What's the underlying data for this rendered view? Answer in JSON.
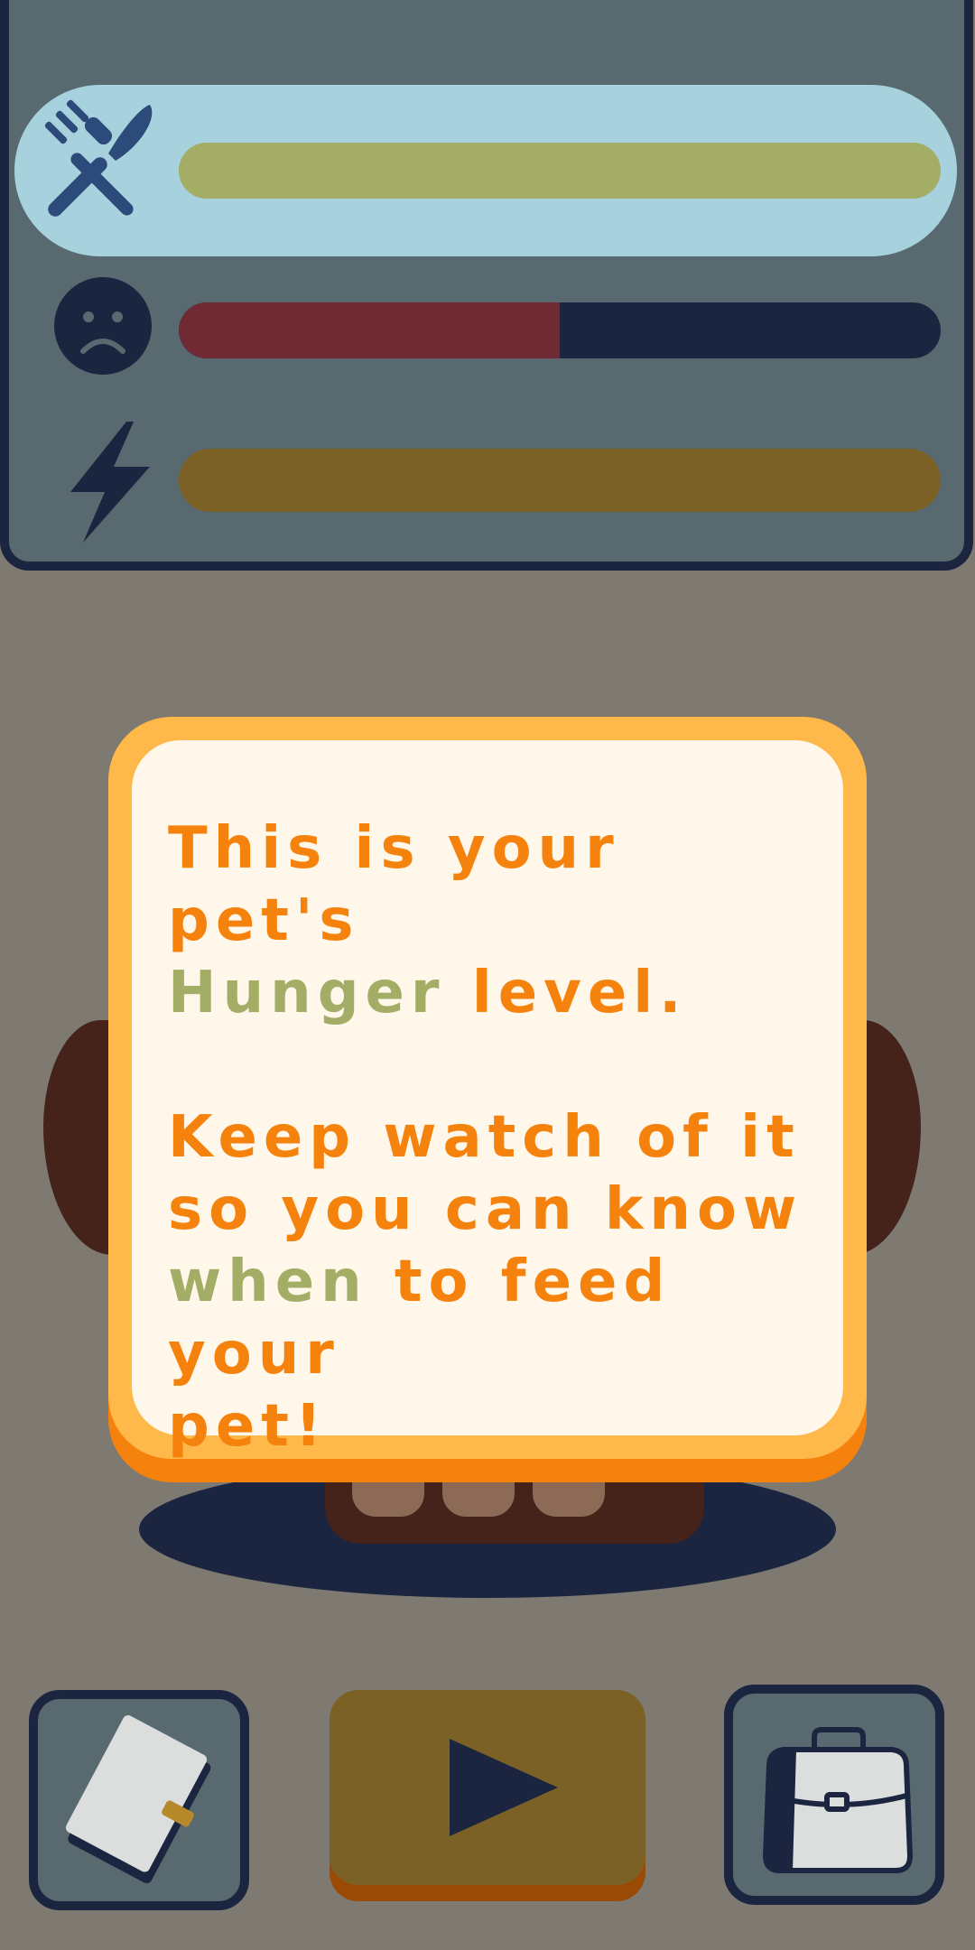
{
  "stats": {
    "hunger": {
      "icon": "fork-knife-icon",
      "level": 1.0,
      "color": "#a3ad66",
      "highlighted": true
    },
    "mood": {
      "icon": "sad-face-icon",
      "level": 0.5,
      "color": "#6f2a34"
    },
    "energy": {
      "icon": "lightning-icon",
      "level": 1.0,
      "color": "#7c6127"
    }
  },
  "dialog": {
    "line1_part1": "This is your pet's",
    "line2_keyword": "Hunger",
    "line2_rest": " level.",
    "para2_line1": "Keep watch of it",
    "para2_line2": "so you can know",
    "para2_line3_keyword": "when",
    "para2_line3_rest": " to feed your",
    "para2_line4": "pet!"
  },
  "buttons": {
    "journal": {
      "icon": "notebook-icon"
    },
    "play": {
      "icon": "play-icon"
    },
    "bag": {
      "icon": "bag-icon"
    }
  },
  "colors": {
    "accent_orange": "#f5820d",
    "keyword_green": "#a3ad66",
    "panel_bg": "#586a70",
    "dark_navy": "#1b2540",
    "dialog_border": "#ffb84a",
    "dialog_bg": "#fef7ea"
  }
}
